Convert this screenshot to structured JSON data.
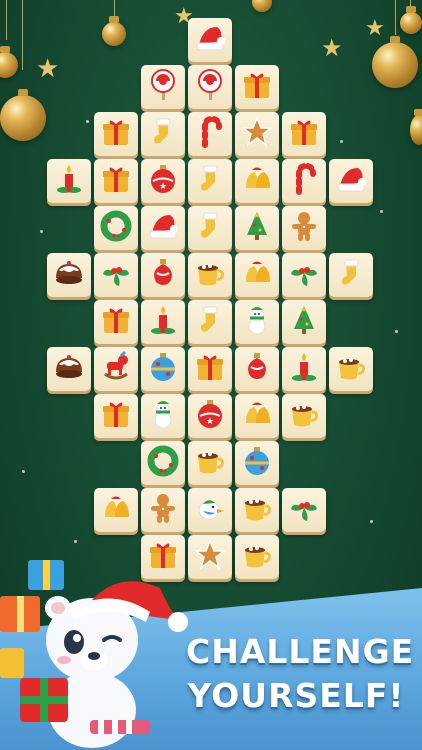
{
  "slogan": {
    "line1": "CHALLENGE",
    "line2": "YOURSELF!"
  },
  "colors": {
    "background": "#154a31",
    "tile_face": "#fbf3de",
    "tile_edge": "#c8a872",
    "banner": "#5aa6de",
    "gold": "#e4b95a"
  },
  "board": {
    "rows": [
      [
        "santa-hat"
      ],
      [
        "lollipop",
        "lollipop",
        "gift-box"
      ],
      [
        "gift-box",
        "stocking",
        "candy-cane",
        "gingerbread-star",
        "gift-box"
      ],
      [
        "candle",
        "gift-box",
        "bauble-red",
        "stocking",
        "bells",
        "candy-cane",
        "santa-hat"
      ],
      [
        "wreath",
        "santa-hat",
        "stocking",
        "christmas-tree",
        "gingerbread-man"
      ],
      [
        "pudding",
        "holly",
        "bauble-ornament",
        "hot-cocoa",
        "bells",
        "holly",
        "stocking"
      ],
      [
        "gift-box",
        "candle",
        "stocking",
        "snowman",
        "christmas-tree"
      ],
      [
        "pudding",
        "rocking-horse",
        "bauble-blue",
        "gift-box",
        "bauble-ornament",
        "candle",
        "hot-cocoa"
      ],
      [
        "gift-box",
        "snowman",
        "bauble-red",
        "bells",
        "hot-cocoa"
      ],
      [
        "wreath",
        "hot-cocoa",
        "bauble-blue"
      ],
      [
        "bells",
        "gingerbread-man",
        "bird",
        "hot-cocoa",
        "holly"
      ],
      [
        "gift-box",
        "gingerbread-star",
        "hot-cocoa"
      ]
    ]
  }
}
